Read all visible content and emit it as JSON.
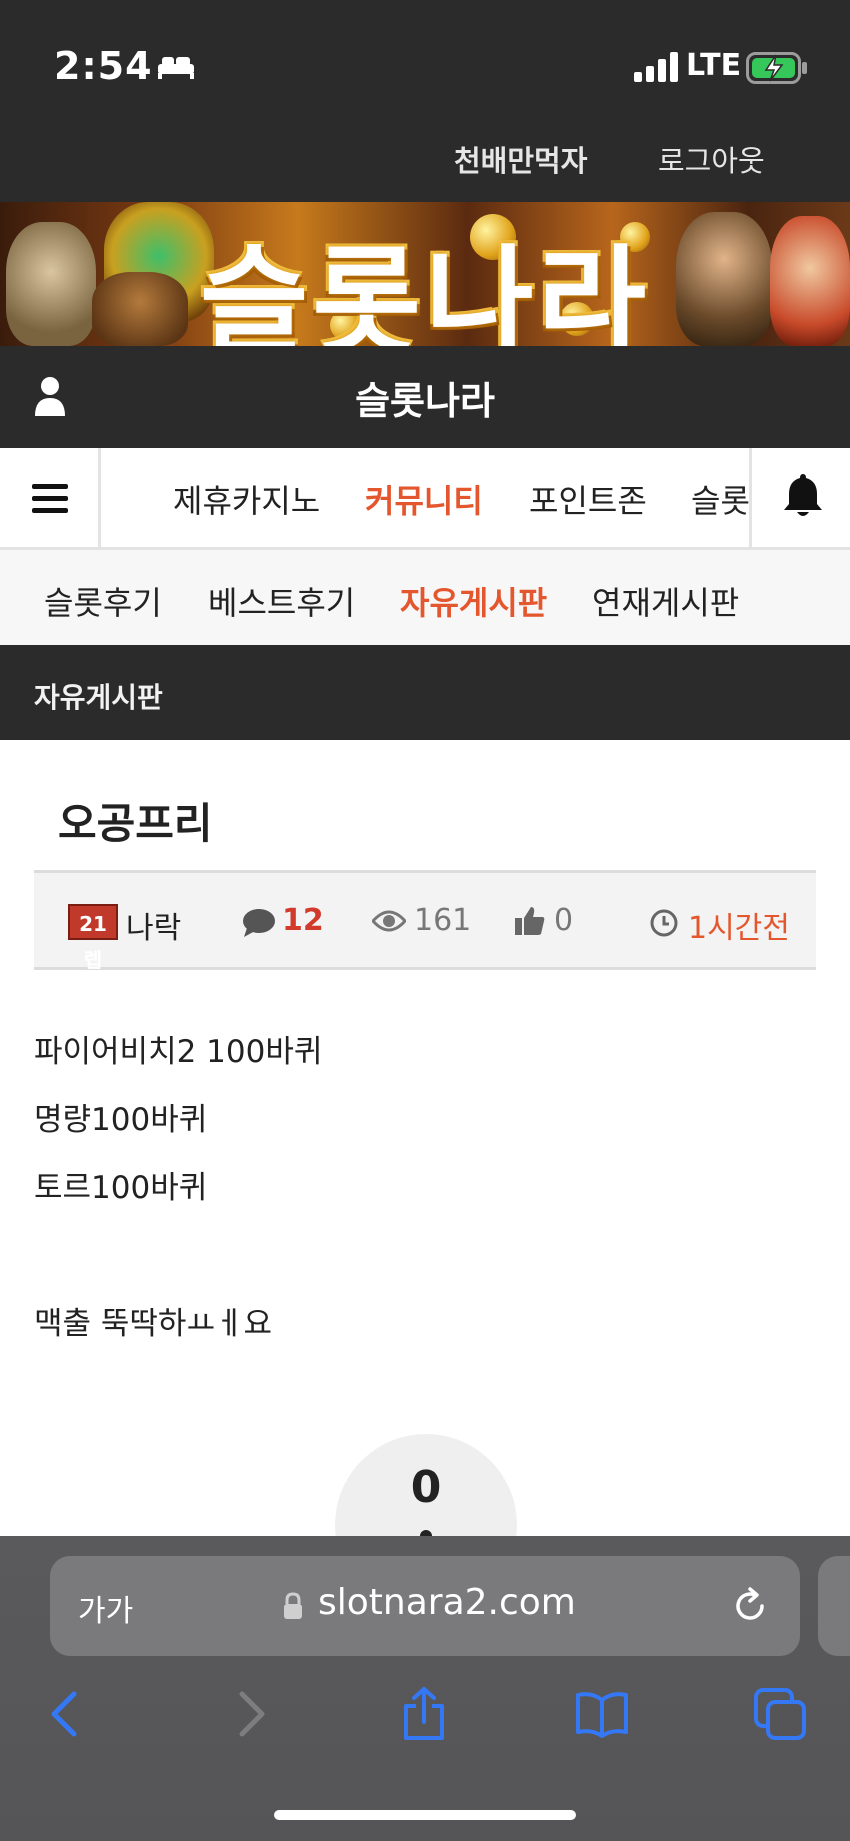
{
  "status_bar": {
    "time": "2:54",
    "network": "LTE"
  },
  "user_bar": {
    "nickname": "천배만먹자",
    "logout": "로그아웃"
  },
  "banner": {
    "title": "슬롯나라"
  },
  "site_header": {
    "title": "슬롯나라"
  },
  "main_nav": {
    "items": [
      {
        "label": "제휴카지노"
      },
      {
        "label": "커뮤니티"
      },
      {
        "label": "포인트존"
      },
      {
        "label": "슬롯"
      }
    ],
    "active_index": 1
  },
  "sub_nav": {
    "items": [
      {
        "label": "슬롯후기"
      },
      {
        "label": "베스트후기"
      },
      {
        "label": "자유게시판"
      },
      {
        "label": "연재게시판"
      }
    ],
    "active_index": 2
  },
  "board": {
    "title": "자유게시판"
  },
  "post": {
    "title": "오공프리",
    "level_badge": "21렙",
    "author": "나락",
    "comments": "12",
    "views": "161",
    "likes": "0",
    "time_ago": "1시간전",
    "body": [
      "파이어비치2 100바퀴",
      "명량100바퀴",
      "토르100바퀴",
      "맥출 뚝딱하ㅛㅔ요"
    ],
    "vote_count": "0"
  },
  "safari": {
    "text_size_label": "가가",
    "url": "slotnara2.com"
  },
  "colors": {
    "accent": "#e4572e",
    "comment_red": "#d23b2b",
    "header_dark": "#2b2b2b",
    "ios_blue": "#3478f6"
  }
}
